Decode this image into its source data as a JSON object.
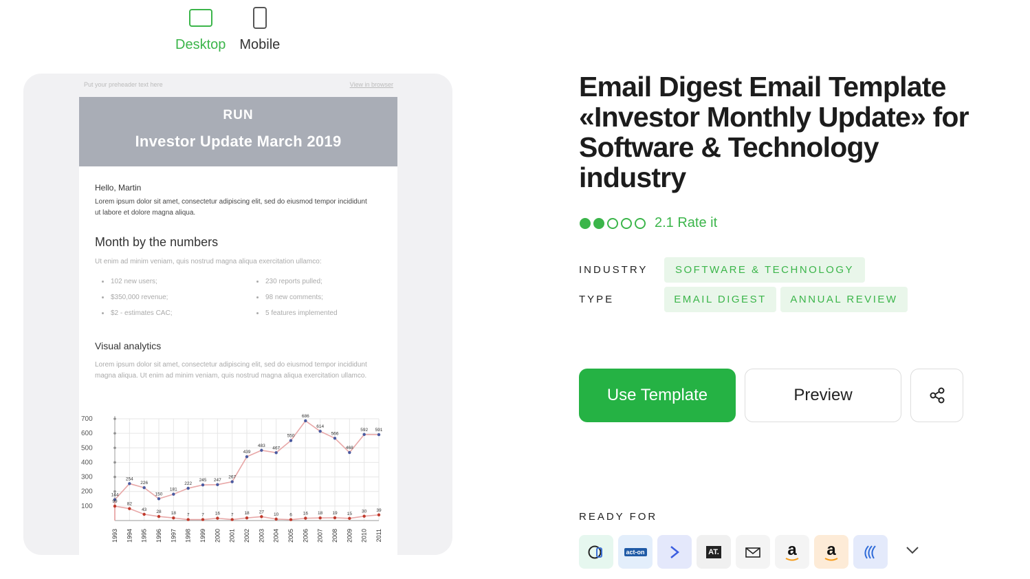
{
  "view_toggle": {
    "desktop_label": "Desktop",
    "mobile_label": "Mobile",
    "active": "desktop"
  },
  "email_preview": {
    "preheader": "Put your preheader text here",
    "view_in_browser": "View in browser",
    "logo_text": "RUN",
    "header_title": "Investor Update March 2019",
    "greeting": "Hello, Martin",
    "intro": "Lorem ipsum dolor sit amet, consectetur adipiscing elit, sed do eiusmod tempor incididunt ut labore et dolore magna aliqua.",
    "numbers_title": "Month by the numbers",
    "numbers_sub": "Ut enim ad minim veniam, quis nostrud magna aliqua exercitation ullamco:",
    "stats": [
      "102 new users;",
      "230 reports pulled;",
      "$350,000 revenue;",
      "98 new comments;",
      "$2 - estimates CAC;",
      "5 features implemented"
    ],
    "analytics_title": "Visual analytics",
    "analytics_text": "Lorem ipsum dolor sit amet, consectetur adipiscing elit, sed do eiusmod tempor incididunt magna aliqua. Ut enim ad minim veniam, quis nostrud magna aliqua exercitation ullamco."
  },
  "chart_data": {
    "type": "line",
    "x": [
      "1993",
      "1994",
      "1995",
      "1996",
      "1997",
      "1998",
      "1999",
      "2000",
      "2001",
      "2002",
      "2003",
      "2004",
      "2005",
      "2006",
      "2007",
      "2008",
      "2009",
      "2010",
      "2011"
    ],
    "ylim": [
      0,
      700
    ],
    "yticks": [
      100,
      200,
      300,
      400,
      500,
      600,
      700
    ],
    "series": [
      {
        "values": [
          144,
          254,
          226,
          150,
          181,
          222,
          245,
          247,
          267,
          439,
          483,
          467,
          550,
          686,
          614,
          566,
          468,
          592,
          591
        ],
        "color": "#4a5aa0"
      },
      {
        "values": [
          99,
          82,
          43,
          28,
          18,
          7,
          7,
          16,
          7,
          18,
          27,
          10,
          6,
          16,
          18,
          19,
          15,
          30,
          39
        ],
        "color": "#c0392b"
      }
    ],
    "line_color": "#e8a7a7"
  },
  "template": {
    "title": "Email Digest Email Template «Investor Monthly Update» for Software & Technology industry",
    "rating": 2.1,
    "rating_text": "2.1 Rate it",
    "industry_label": "INDUSTRY",
    "industry_tags": [
      "SOFTWARE & TECHNOLOGY"
    ],
    "type_label": "TYPE",
    "type_tags": [
      "EMAIL DIGEST",
      "ANNUAL REVIEW"
    ]
  },
  "actions": {
    "use_label": "Use Template",
    "preview_label": "Preview",
    "share_icon": "share-icon"
  },
  "ready_for": {
    "label": "READY FOR",
    "esps": [
      {
        "name": "campaign-monitor-icon",
        "bg": "#e6f7ef"
      },
      {
        "name": "act-on-icon",
        "text": "act-on",
        "bg": "#e3eefb"
      },
      {
        "name": "arrow-esp-icon",
        "bg": "#e4e8fb"
      },
      {
        "name": "at-esp-icon",
        "text": "AT.",
        "bg": "#f0f0f0"
      },
      {
        "name": "mail-esp-icon",
        "bg": "#f4f4f4"
      },
      {
        "name": "amazon-icon",
        "text": "a",
        "bg": "#f4f4f4"
      },
      {
        "name": "amazon-ses-icon",
        "text": "a",
        "bg": "#fdebd7"
      },
      {
        "name": "waves-esp-icon",
        "bg": "#e4eafb"
      }
    ],
    "more_icon": "chevron-down-icon"
  }
}
